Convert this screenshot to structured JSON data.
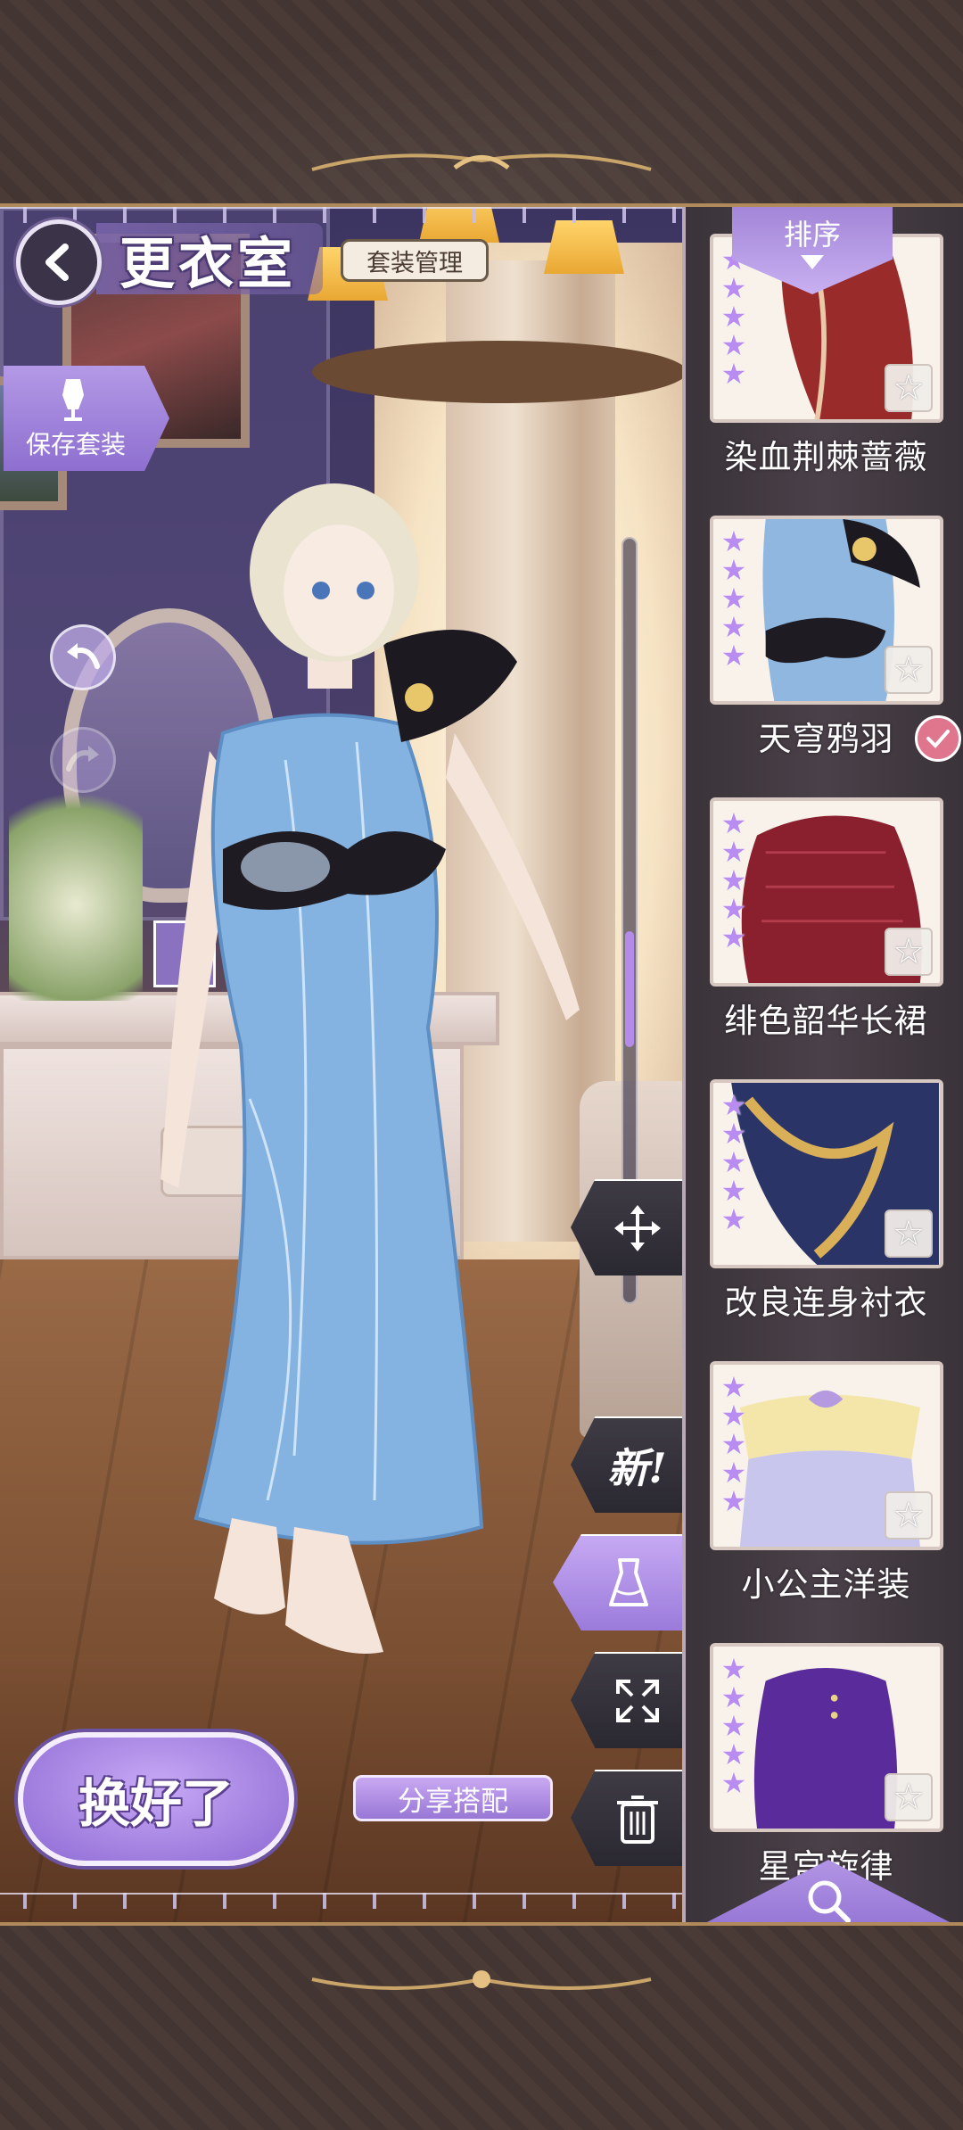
{
  "header": {
    "title": "更衣室",
    "outfit_manage_label": "套装管理",
    "save_outfit_label": "保存套装"
  },
  "side_tools": {
    "new_label": "新!"
  },
  "bottom": {
    "done_label": "换好了",
    "share_label": "分享搭配"
  },
  "wardrobe": {
    "sort_label": "排序",
    "items": [
      {
        "name": "染血荆棘蔷薇",
        "stars": 5,
        "equipped": false,
        "color": "#9a2b2b"
      },
      {
        "name": "天穹鸦羽",
        "stars": 5,
        "equipped": true,
        "color": "#8fb7e0"
      },
      {
        "name": "绯色韶华长裙",
        "stars": 5,
        "equipped": false,
        "color": "#8a1f2e"
      },
      {
        "name": "改良连身衬衣",
        "stars": 5,
        "equipped": false,
        "color": "#2a3466"
      },
      {
        "name": "小公主洋装",
        "stars": 5,
        "equipped": false,
        "color": "#c9c6ee"
      },
      {
        "name": "星宫旋律",
        "stars": 5,
        "equipped": false,
        "color": "#5a2b9a"
      }
    ]
  },
  "colors": {
    "accent": "#a98be2",
    "frame": "#433531",
    "panel": "#443b43"
  },
  "icons": [
    "back-chevron-icon",
    "mannequin-save-icon",
    "undo-arrow-icon",
    "move-arrows-icon",
    "dress-icon",
    "fullscreen-icon",
    "trash-icon",
    "search-icon",
    "star-icon",
    "check-icon"
  ]
}
